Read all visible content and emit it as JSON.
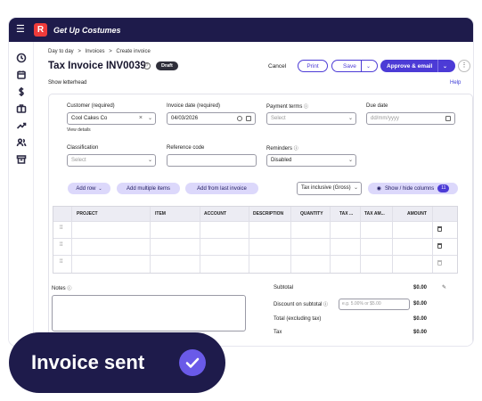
{
  "app": {
    "title": "Get Up Costumes",
    "logo_letter": "R"
  },
  "sidebar": {
    "icons": [
      "clock-icon",
      "calendar-icon",
      "dollar-icon",
      "briefcase-icon",
      "trend-icon",
      "users-icon",
      "archive-icon"
    ]
  },
  "breadcrumb": [
    "Day to day",
    ">",
    "Invoices",
    ">",
    "Create invoice"
  ],
  "header": {
    "title": "Tax Invoice INV0039",
    "status": "Draft",
    "cancel": "Cancel",
    "print": "Print",
    "save": "Save",
    "approve": "Approve & email",
    "show_letterhead": "Show letterhead",
    "help": "Help"
  },
  "form": {
    "customer": {
      "label": "Customer (required)",
      "value": "Cool Cakes Co",
      "link": "View details"
    },
    "invoice_date": {
      "label": "Invoice date (required)",
      "value": "04/03/2026"
    },
    "payment_terms": {
      "label": "Payment terms",
      "placeholder": "Select"
    },
    "due_date": {
      "label": "Due date",
      "placeholder": "dd/mm/yyyy"
    },
    "classification": {
      "label": "Classification",
      "placeholder": "Select"
    },
    "reference": {
      "label": "Reference code",
      "value": ""
    },
    "reminders": {
      "label": "Reminders",
      "value": "Disabled"
    }
  },
  "actions": {
    "add_row": "Add row",
    "add_multiple": "Add multiple items",
    "add_last": "Add from last invoice",
    "tax_mode": "Tax inclusive (Gross)",
    "show_hide": "Show / hide columns",
    "column_count": "11"
  },
  "table": {
    "columns": [
      "PROJECT",
      "ITEM",
      "ACCOUNT",
      "DESCRIPTION",
      "QUANTITY",
      "TAX ...",
      "TAX AM...",
      "AMOUNT"
    ],
    "row_count": 3
  },
  "notes": {
    "label": "Notes"
  },
  "totals": {
    "subtotal": {
      "label": "Subtotal",
      "value": "$0.00"
    },
    "discount": {
      "label": "Discount on subtotal",
      "placeholder": "e.g. 5.00% or $5.00",
      "value": "$0.00"
    },
    "total_excl": {
      "label": "Total (excluding tax)",
      "value": "$0.00"
    },
    "tax": {
      "label": "Tax",
      "value": "$0.00"
    }
  },
  "toast": {
    "text": "Invoice sent"
  }
}
